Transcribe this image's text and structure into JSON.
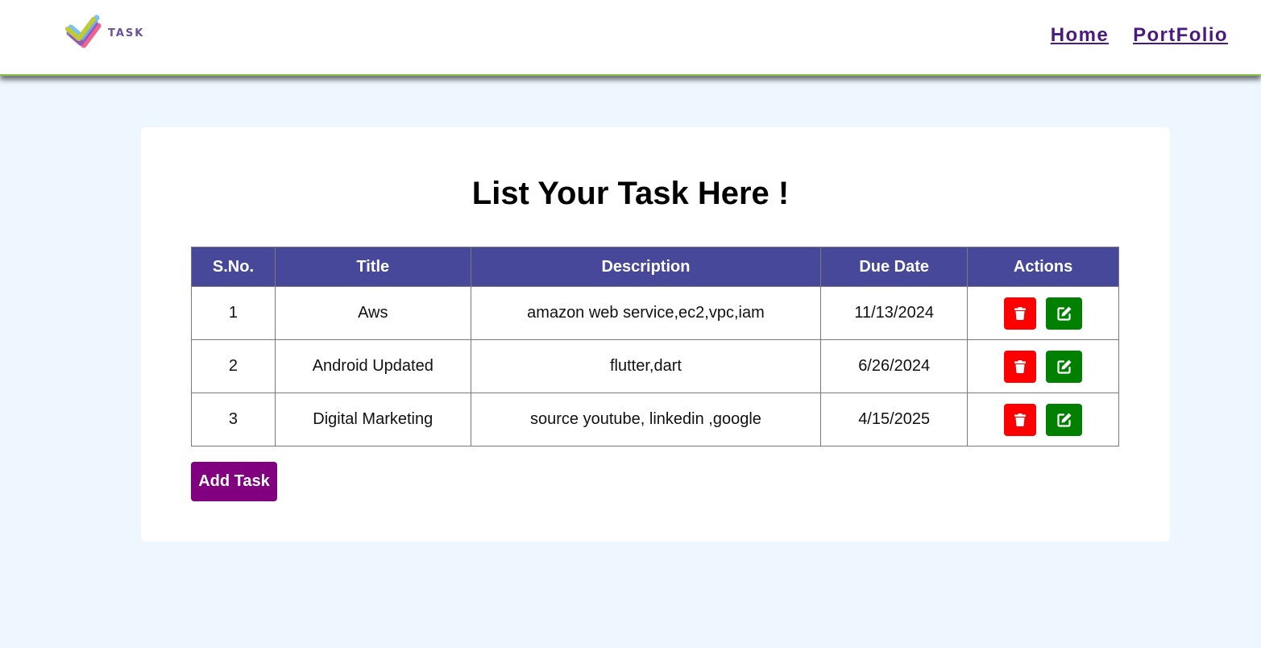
{
  "app": {
    "logo_text": "TASK"
  },
  "nav": {
    "links": [
      {
        "label": "Home"
      },
      {
        "label": "PortFolio"
      }
    ]
  },
  "main": {
    "title": "List Your Task Here !",
    "add_button_label": "Add Task"
  },
  "table": {
    "columns": [
      "S.No.",
      "Title",
      "Description",
      "Due Date",
      "Actions"
    ],
    "rows": [
      {
        "sno": "1",
        "title": "Aws",
        "description": "amazon web service,ec2,vpc,iam",
        "due": "11/13/2024"
      },
      {
        "sno": "2",
        "title": "Android Updated",
        "description": "flutter,dart",
        "due": "6/26/2024"
      },
      {
        "sno": "3",
        "title": "Digital Marketing",
        "description": "source youtube, linkedin ,google",
        "due": "4/15/2025"
      }
    ],
    "row_actions": {
      "delete_icon": "trash-icon",
      "edit_icon": "edit-icon"
    }
  },
  "colors": {
    "page_bg": "#eef6ff",
    "header_bg": "#474899",
    "delete": "#ff0000",
    "edit": "#008000",
    "add_button": "#800080",
    "nav_link": "#4a1a7e"
  }
}
